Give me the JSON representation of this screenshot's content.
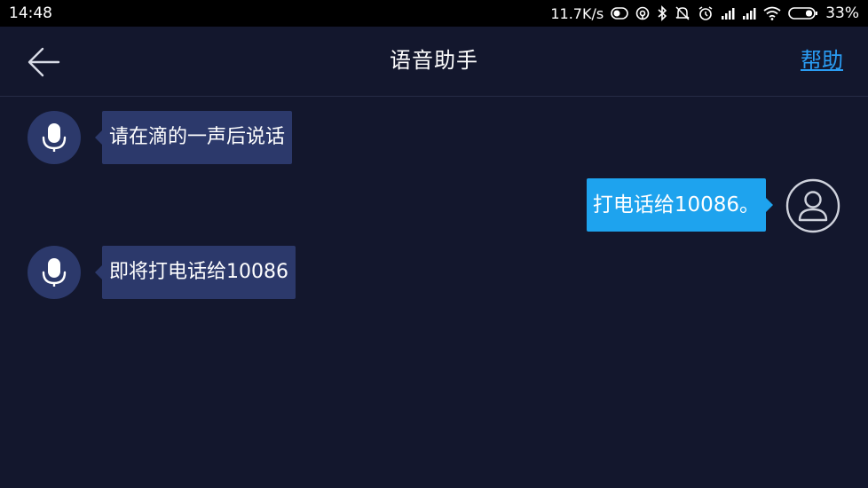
{
  "status_bar": {
    "time": "14:48",
    "net_speed": "11.7K/s",
    "battery_percent": "33%",
    "icons": [
      "hotspot-icon",
      "data-saver-icon",
      "bluetooth-icon",
      "mute-icon",
      "alarm-icon",
      "signal-icon",
      "signal-icon",
      "wifi-icon",
      "battery-icon"
    ]
  },
  "header": {
    "title": "语音助手",
    "help_label": "帮助",
    "back_icon": "arrow-left-icon"
  },
  "messages": [
    {
      "sender": "assistant",
      "text": "请在滴的一声后说话",
      "avatar_icon": "microphone-icon"
    },
    {
      "sender": "user",
      "text": "打电话给10086。",
      "avatar_icon": "user-icon"
    },
    {
      "sender": "assistant",
      "text": "即将打电话给10086",
      "avatar_icon": "microphone-icon"
    }
  ],
  "colors": {
    "background": "#13172d",
    "assistant_bubble": "#2c396b",
    "user_bubble": "#1ea3ee",
    "link": "#2a9df4"
  }
}
